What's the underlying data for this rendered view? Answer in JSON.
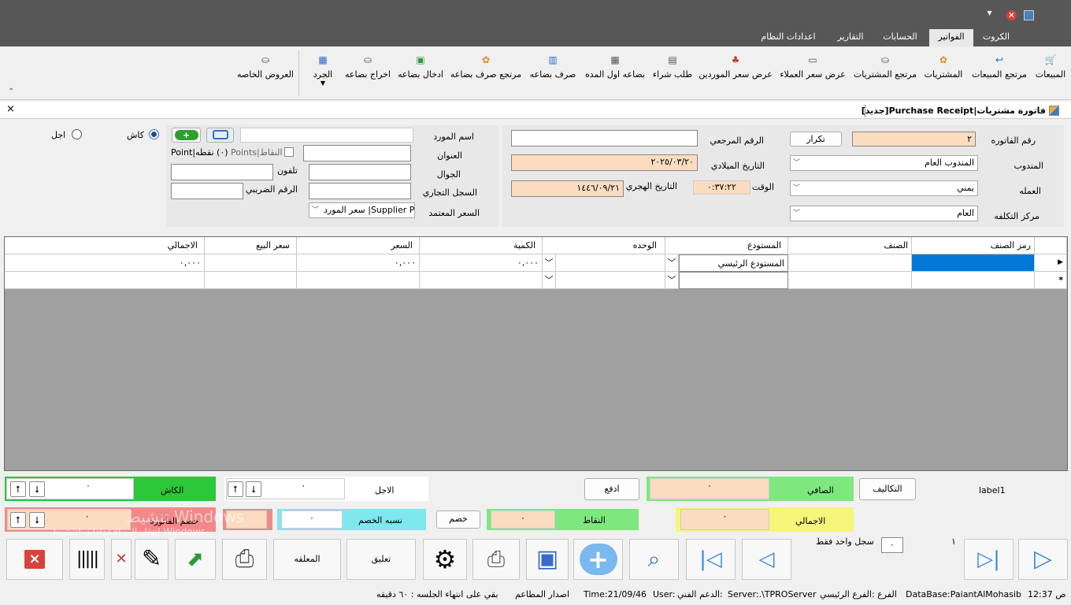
{
  "window": {
    "min_icon": "minimize-icon",
    "close_icon": "close-icon"
  },
  "tabs": [
    "الكروت",
    "الفواتير",
    "الحسابات",
    "التقارير",
    "اعدادات النظام"
  ],
  "ribbon": [
    "المبيعات",
    "مرتجع المبيعات",
    "المشتريات",
    "مرتجع المشتريات",
    "عرض سعر العملاء",
    "عرض سعر الموردين",
    "طلب شراء",
    "بضاعه اول المده",
    "صرف بضاعه",
    "مرتجع صرف بضاعه",
    "ادخال بضاعه",
    "اخراج بضاعه",
    "الجرد",
    "العروض الخاصه"
  ],
  "doc": {
    "title": "فاتورة مشتريات|Purchase Receipt[جديد]"
  },
  "invoice": {
    "number_label": "رقم الفاتوره",
    "number": "٢",
    "repeat_btn": "تكرار",
    "ref_label": "الرقم المرجعي",
    "ref": "",
    "rep_label": "المندوب",
    "rep": "المندوب العام",
    "greg_label": "التاريخ الميلادي",
    "greg": "٢٠٢٥/٠٣/٢٠",
    "currency_label": "العمله",
    "currency": "يمني",
    "time_label": "الوقت",
    "time": "٠:٣٧:٢٢",
    "hijri_label": "التاريخ الهجري",
    "hijri": "١٤٤٦/٠٩/٢١",
    "cost_label": "مركز التكلفه",
    "cost": "العام"
  },
  "supplier": {
    "name_label": "اسم المورد",
    "name": "",
    "address_label": "العنوان",
    "mobile_label": "الجوال",
    "phone_label": "تلفون",
    "cr_label": "السجل التجاري",
    "tax_label": "الرقم الضريبي",
    "price_label": "السعر المعتمد",
    "price": "سعر المورد |Supplier Price",
    "points_label": "النقاط|Points",
    "points_value": "(٠) نقطه|Point"
  },
  "payment": {
    "cash": "كاش",
    "credit": "اجل"
  },
  "grid": {
    "headers": [
      "رمز الصنف",
      "الصنف",
      "المستودع",
      "الوحده",
      "الكمية",
      "السعر",
      "سعر البيع",
      "الاجمالي"
    ],
    "row1": {
      "warehouse": "المستودع الرئيسي",
      "qty": "٠,٠٠٠",
      "price": "٠,٠٠٠",
      "total": "٠,٠٠٠"
    },
    "new_row_marker": "*",
    "cur_row_marker": "▶"
  },
  "totals": {
    "label1": "label1",
    "costs_btn": "التكاليف",
    "net_label": "الصافي",
    "net": "٠",
    "pay_btn": "ادفع",
    "credit_label": "الاجل",
    "credit": "٠",
    "cash_label": "الكاش",
    "cash": "٠",
    "total_label": "الاجمالي",
    "total": "٠",
    "points_label": "النقاط",
    "points": "٠",
    "discount_btn": "خصم",
    "disc_pct_label": "نسبه الخصم",
    "disc_pct": "٠",
    "disc_inv_label": "خصم الفاتوره",
    "disc_inv": "٠"
  },
  "toolbar": {
    "one_record": "سجل واحد فقط",
    "record_box": "٠",
    "record_num": "١",
    "suspend": "تعليق",
    "suspended": "المعلقه"
  },
  "watermark": {
    "line1": "تنشيط Windows",
    "line2": "انتقل إلى الإعدادات لتنشيط Windows."
  },
  "status": {
    "clock": "12:37 ص",
    "db": "DataBase:PaiantAlMohasib",
    "branch": "الفرع :الفرع الرئيسي",
    "server": "Server:.\\TPROServer",
    "support": "الدعم الفني:",
    "user": "User:",
    "time": "Time:21/09/46",
    "version": "اصدار المطاعم",
    "session": "بقي على انتهاء الجلسه : ٦٠ دقيقه"
  }
}
